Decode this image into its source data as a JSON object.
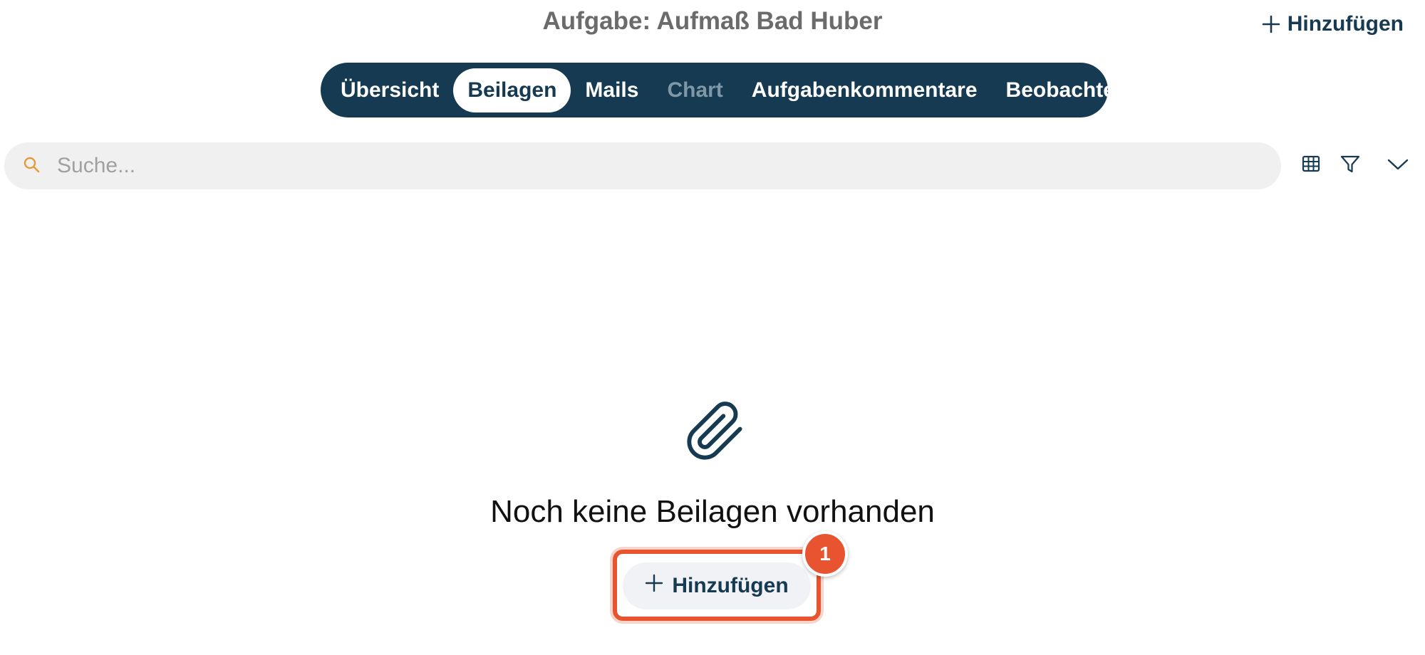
{
  "page": {
    "title": "Aufgabe: Aufmaß Bad Huber"
  },
  "header": {
    "add_label": "Hinzufügen",
    "add_icon": "plus-icon"
  },
  "tabs": [
    {
      "label": "Übersicht",
      "state": "normal"
    },
    {
      "label": "Beilagen",
      "state": "active"
    },
    {
      "label": "Mails",
      "state": "normal"
    },
    {
      "label": "Chart",
      "state": "disabled"
    },
    {
      "label": "Aufgabenkommentare",
      "state": "normal"
    },
    {
      "label": "Beobachter",
      "state": "normal"
    }
  ],
  "search": {
    "placeholder": "Suche...",
    "value": "",
    "icon": "search-icon"
  },
  "toolbar": {
    "icons": [
      "table-icon",
      "filter-icon",
      "chevron-down-icon"
    ]
  },
  "empty_state": {
    "icon": "paperclip-icon",
    "message": "Noch keine Beilagen vorhanden",
    "add_label": "Hinzufügen",
    "step_badge": "1"
  },
  "colors": {
    "primary": "#163a52",
    "accent": "#e85430",
    "search_icon": "#e39a3b",
    "tab_disabled": "#7e98a8"
  }
}
